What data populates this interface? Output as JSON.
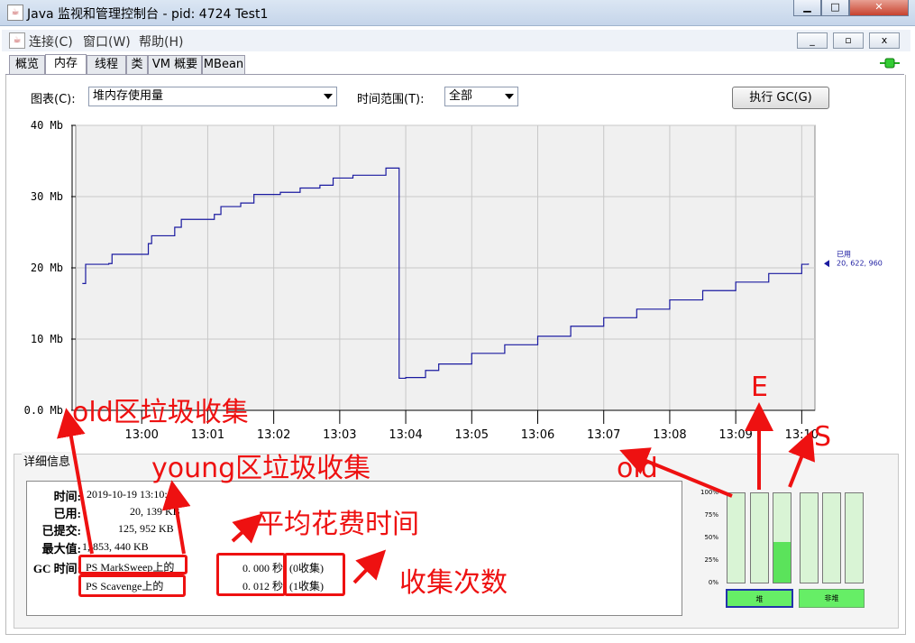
{
  "window": {
    "title": "Java 监视和管理控制台 - pid: 4724 Test1",
    "app_icon": "java-cup-icon"
  },
  "menu": {
    "items": [
      "连接(C)",
      "窗口(W)",
      "帮助(H)"
    ]
  },
  "tabs": [
    "概览",
    "内存",
    "线程",
    "类",
    "VM 概要",
    "MBean"
  ],
  "active_tab": "内存",
  "controls": {
    "chart_label": "图表(C):",
    "chart_value": "堆内存使用量",
    "range_label": "时间范围(T):",
    "range_value": "全部",
    "gc_button": "执行 GC(G)"
  },
  "chart_data": {
    "type": "line",
    "ylim": [
      0,
      40
    ],
    "y_ticks": [
      "0.0 Mb",
      "10 Mb",
      "20 Mb",
      "30 Mb",
      "40 Mb"
    ],
    "x_ticks": [
      "13:00",
      "13:01",
      "13:02",
      "13:03",
      "13:04",
      "13:05",
      "13:06",
      "13:07",
      "13:08",
      "13:09",
      "13:10"
    ],
    "series": [
      {
        "name": "已用",
        "color": "#1a1aa0",
        "x": [
          "12:59:06",
          "12:59:09",
          "12:59:30",
          "12:59:33",
          "13:00:06",
          "13:00:09",
          "13:00:30",
          "13:00:36",
          "13:01:06",
          "13:01:12",
          "13:01:30",
          "13:01:42",
          "13:02:06",
          "13:02:24",
          "13:02:42",
          "13:02:54",
          "13:03:12",
          "13:03:42",
          "13:03:48",
          "13:03:54",
          "13:04:00",
          "13:04:18",
          "13:04:30",
          "13:05:00",
          "13:05:30",
          "13:06:00",
          "13:06:30",
          "13:07:00",
          "13:07:30",
          "13:08:00",
          "13:08:30",
          "13:09:00",
          "13:09:30",
          "13:10:00",
          "13:10:06"
        ],
        "values": [
          17.8,
          20.5,
          20.6,
          21.9,
          23.4,
          24.5,
          25.7,
          26.8,
          27.5,
          28.6,
          29.1,
          30.3,
          30.6,
          31.2,
          31.6,
          32.6,
          33.0,
          34.0,
          34.0,
          4.5,
          4.6,
          5.6,
          6.5,
          8.0,
          9.2,
          10.4,
          11.8,
          13.0,
          14.2,
          15.5,
          16.8,
          18.0,
          19.2,
          20.5,
          20.6
        ]
      }
    ],
    "marker_label": "已用",
    "marker_value": "20, 622, 960"
  },
  "details": {
    "title": "详细信息",
    "rows": [
      {
        "label": "时间:",
        "value": "2019-10-19 13:10:"
      },
      {
        "label": "已用:",
        "value": "20, 139 KB"
      },
      {
        "label": "已提交:",
        "value": "125, 952 KB"
      },
      {
        "label": "最大值:",
        "value": "1, 853, 440 KB"
      }
    ],
    "gc_label": "GC 时间:",
    "gc_rows": [
      {
        "name": "PS MarkSweep上的",
        "time": "0. 000 秒",
        "count": "(0收集)"
      },
      {
        "name": "PS Scavenge上的",
        "time": "0. 012 秒",
        "count": "(1收集)"
      }
    ]
  },
  "pools": {
    "pct_labels": [
      "100%",
      "75%",
      "50%",
      "25%",
      "0%"
    ],
    "bars": [
      {
        "name": "old",
        "fill": 0.0
      },
      {
        "name": "E",
        "fill": 0.0
      },
      {
        "name": "S",
        "fill": 0.45
      },
      {
        "name": "non-heap-1",
        "fill": 0.0
      },
      {
        "name": "non-heap-2",
        "fill": 0.0
      },
      {
        "name": "non-heap-3",
        "fill": 0.0
      }
    ],
    "heap_label": "堆",
    "nonheap_label": "非堆"
  },
  "annotations": {
    "old_gc": "old区垃圾收集",
    "young_gc": "young区垃圾收集",
    "avg_time": "平均花费时间",
    "count": "收集次数",
    "old": "old",
    "e": "E",
    "s": "S",
    "color": "#ee1111"
  }
}
